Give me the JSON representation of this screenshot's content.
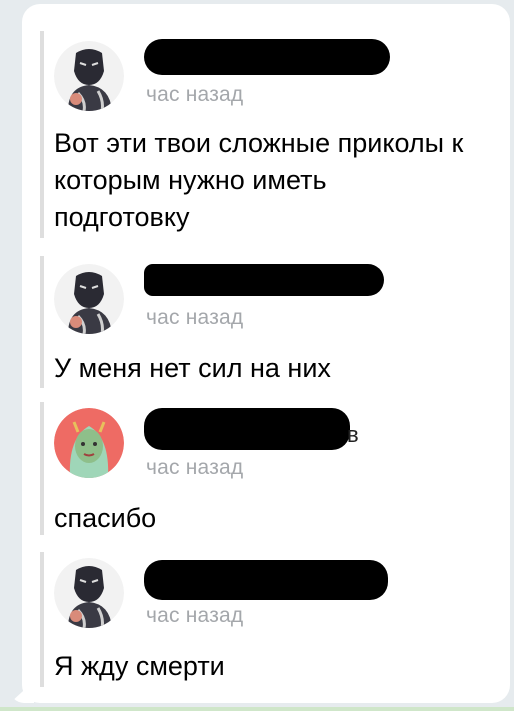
{
  "messages": [
    {
      "sender_name": "",
      "avatar": "man-portrait-icon",
      "time": "час назад",
      "text": "Вот эти твои сложные приколы к которым нужно иметь подготовку"
    },
    {
      "sender_name": "",
      "avatar": "man-portrait-icon",
      "time": "час назад",
      "text": "У меня нет сил на них"
    },
    {
      "sender_name": "",
      "avatar": "girl-portrait-icon",
      "time": "час назад",
      "text": "спасибо",
      "name_tail": "в"
    },
    {
      "sender_name": "",
      "avatar": "man-portrait-icon",
      "time": "час назад",
      "text": "Я жду смерти"
    }
  ],
  "colors": {
    "bubble": "#ffffff",
    "background": "#e6ebee",
    "timestamp": "#a4a7ab",
    "quote_bar": "#dedede",
    "avatar_girl_bg": "#ee6b64"
  }
}
